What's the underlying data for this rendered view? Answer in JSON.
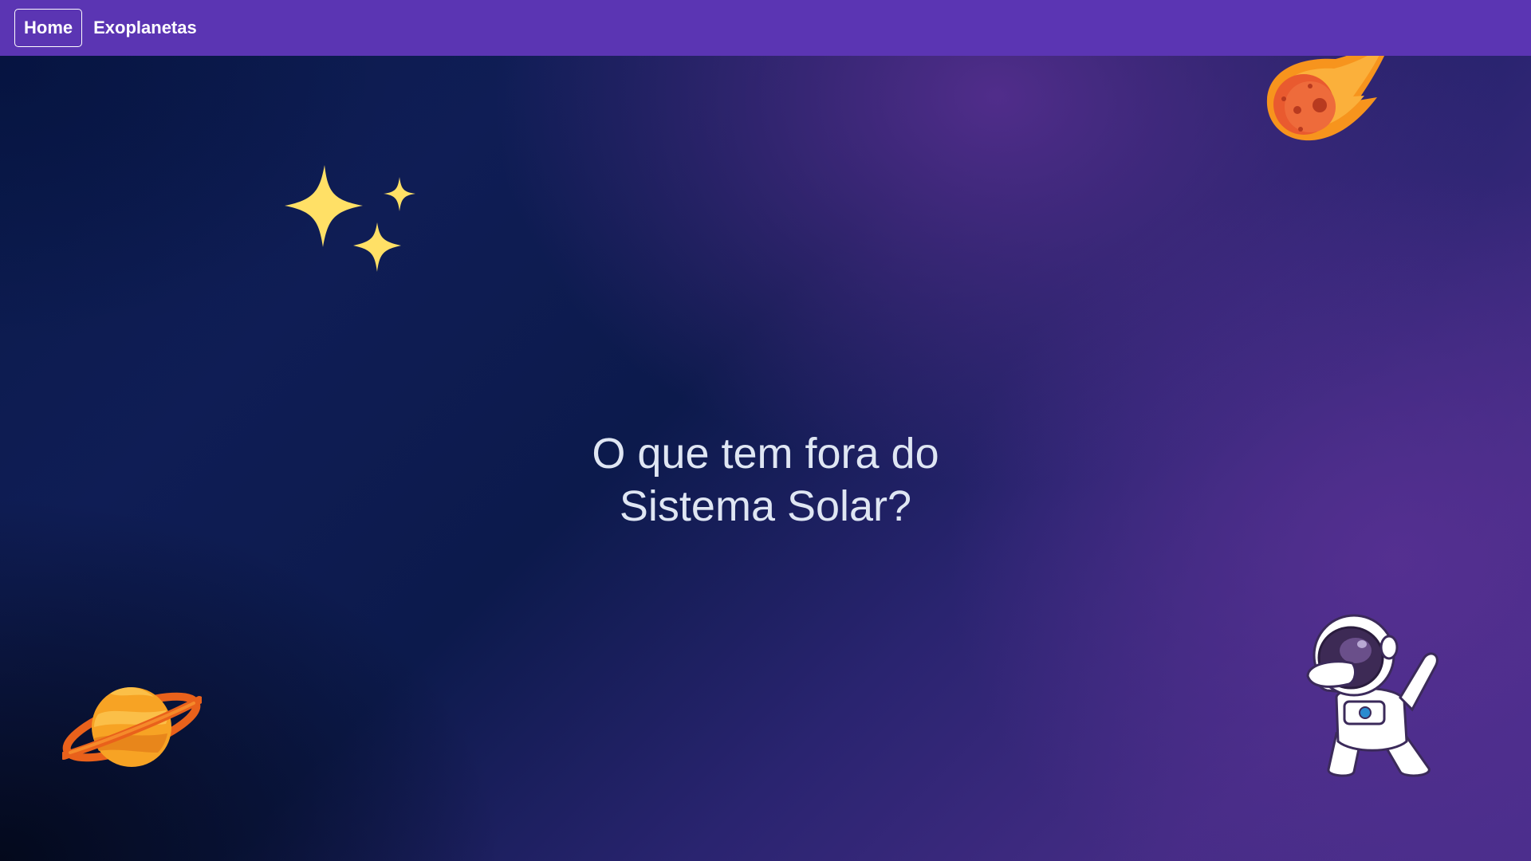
{
  "navbar": {
    "links": [
      {
        "label": "Home",
        "active": true
      },
      {
        "label": "Exoplanetas",
        "active": false
      }
    ],
    "background": "#5b35b3"
  },
  "hero": {
    "line1": "O que tem fora do",
    "line2": "Sistema Solar?"
  },
  "decorations": {
    "sparkles": "sparkles-icon",
    "comet": "comet-icon",
    "planet": "saturn-planet-icon",
    "astronaut": "dabbing-astronaut-illustration"
  },
  "colors": {
    "star_yellow": "#ffe066",
    "comet_orange": "#f7941d",
    "planet_orange": "#f39a1e"
  }
}
